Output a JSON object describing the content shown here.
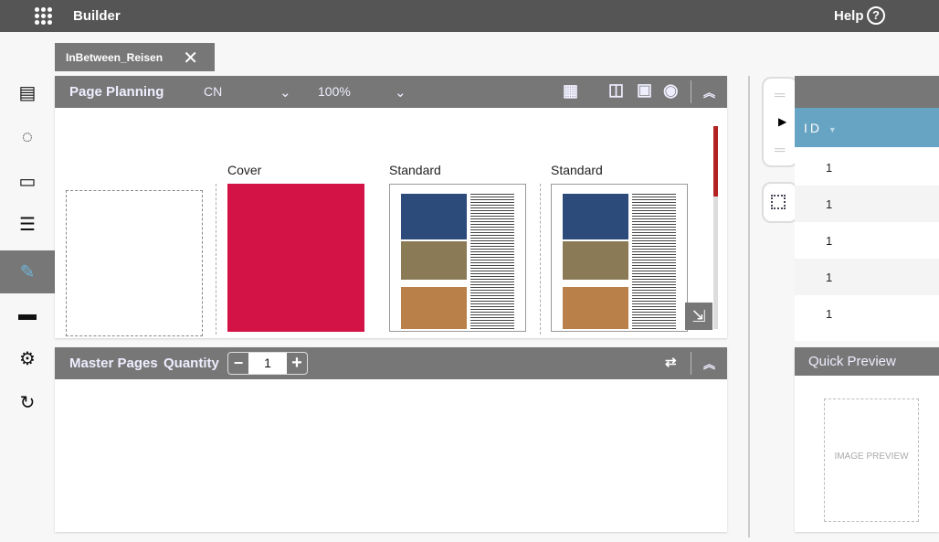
{
  "topbar": {
    "title": "Builder",
    "help": "Help",
    "help_icon": "?"
  },
  "tab": {
    "label": "InBetween_Reisen"
  },
  "page_planning": {
    "title": "Page Planning",
    "language": "CN",
    "zoom": "100%",
    "pages": [
      {
        "label": ""
      },
      {
        "label": "Cover",
        "color": "#d31245"
      },
      {
        "label": "Standard"
      },
      {
        "label": "Standard"
      }
    ]
  },
  "master_pages": {
    "title": "Master Pages",
    "quantity_label": "Quantity",
    "quantity": "1"
  },
  "table": {
    "id_header": "ID",
    "rows": [
      "1",
      "1",
      "1",
      "1",
      "1"
    ]
  },
  "quick_preview": {
    "title": "Quick Preview",
    "image_placeholder": "IMAGE PREVIEW"
  },
  "colors": {
    "accent": "#67a3c2",
    "topbar": "#555555",
    "panel_header": "#777777"
  }
}
